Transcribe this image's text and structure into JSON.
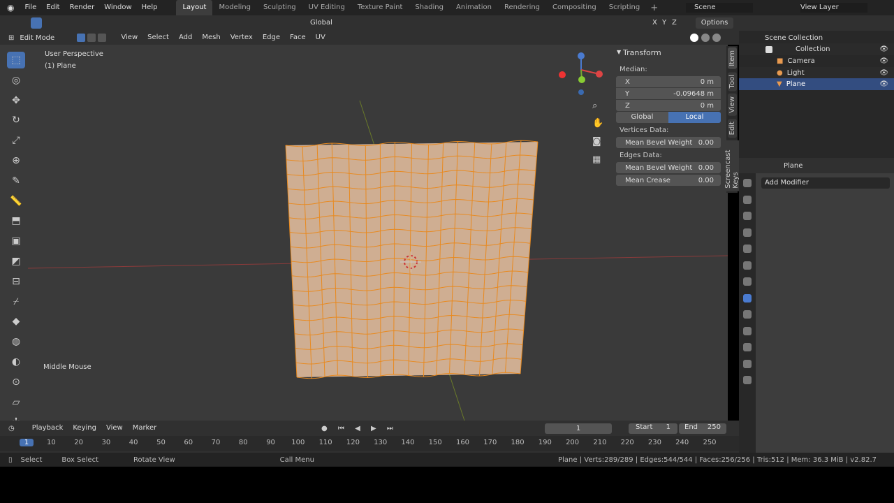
{
  "topbar": {
    "menus": [
      "File",
      "Edit",
      "Render",
      "Window",
      "Help"
    ],
    "workspaces": [
      "Layout",
      "Modeling",
      "Sculpting",
      "UV Editing",
      "Texture Paint",
      "Shading",
      "Animation",
      "Rendering",
      "Compositing",
      "Scripting"
    ],
    "scene": "Scene",
    "view_layer": "View Layer"
  },
  "toolheader": {
    "orientation": "Global",
    "options": "Options",
    "axes": [
      "X",
      "Y",
      "Z"
    ]
  },
  "viewport_header": {
    "mode": "Edit Mode",
    "menus": [
      "View",
      "Select",
      "Add",
      "Mesh",
      "Vertex",
      "Edge",
      "Face",
      "UV"
    ]
  },
  "viewport": {
    "perspective": "User Perspective",
    "object": "(1) Plane",
    "screencast": "Middle Mouse",
    "mesh_grid": {
      "cols": 16,
      "rows": 16
    }
  },
  "npanel": {
    "title": "Transform",
    "median": "Median:",
    "x_label": "X",
    "x": "0 m",
    "y_label": "Y",
    "y": "-0.09648 m",
    "z_label": "Z",
    "z": "0 m",
    "global": "Global",
    "local": "Local",
    "vertices_data": "Vertices Data:",
    "mean_bevel_weight": "Mean Bevel Weight",
    "v_bevel": "0.00",
    "edges_data": "Edges Data:",
    "e_bevel": "0.00",
    "mean_crease": "Mean Crease",
    "crease": "0.00",
    "tabs": [
      "Item",
      "Tool",
      "View",
      "Edit",
      "Screencast Keys"
    ]
  },
  "outliner": {
    "root": "Scene Collection",
    "collection": "Collection",
    "items": [
      "Camera",
      "Light",
      "Plane"
    ]
  },
  "properties": {
    "object": "Plane",
    "add_modifier": "Add Modifier"
  },
  "timeline": {
    "menus": [
      "Playback",
      "Keying",
      "View",
      "Marker"
    ],
    "current_frame": "1",
    "start_label": "Start",
    "start": "1",
    "end_label": "End",
    "end": "250",
    "ticks": [
      "1",
      "10",
      "20",
      "30",
      "40",
      "50",
      "60",
      "70",
      "80",
      "90",
      "100",
      "110",
      "120",
      "130",
      "140",
      "150",
      "160",
      "170",
      "180",
      "190",
      "200",
      "210",
      "220",
      "230",
      "240",
      "250"
    ]
  },
  "status": {
    "select": "Select",
    "box_select": "Box Select",
    "rotate": "Rotate View",
    "call_menu": "Call Menu",
    "stats": "Plane | Verts:289/289 | Edges:544/544 | Faces:256/256 | Tris:512 | Mem: 36.3 MiB | v2.82.7"
  },
  "colors": {
    "accent": "#4772b3",
    "mesh_face": "#cfae92",
    "mesh_edge": "#e88a20"
  }
}
